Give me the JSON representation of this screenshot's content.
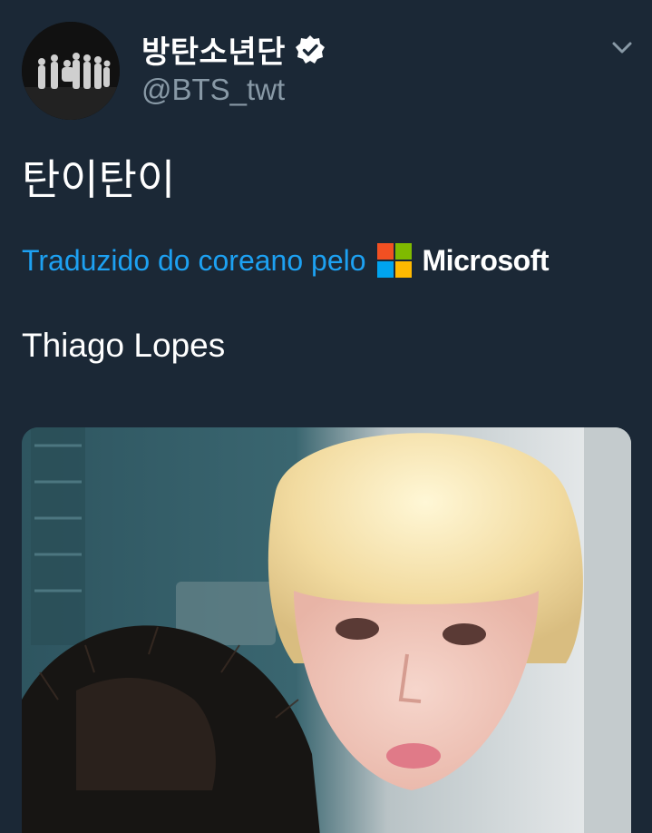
{
  "tweet": {
    "author": {
      "display_name": "방탄소년단",
      "handle": "@BTS_twt",
      "verified": true,
      "avatar_icon": "group-photo-avatar"
    },
    "menu_icon": "chevron-down-icon",
    "text": "탄이탄이",
    "translation": {
      "link_text": "Traduzido do coreano pelo",
      "provider": "Microsoft"
    },
    "translated_text": "Thiago Lopes",
    "media_icon": "photo-image"
  },
  "colors": {
    "background": "#1b2836",
    "link": "#1da1f2",
    "secondary_text": "#8899a6",
    "ms_red": "#f25022",
    "ms_green": "#7fba00",
    "ms_blue": "#00a4ef",
    "ms_yellow": "#ffb900"
  }
}
